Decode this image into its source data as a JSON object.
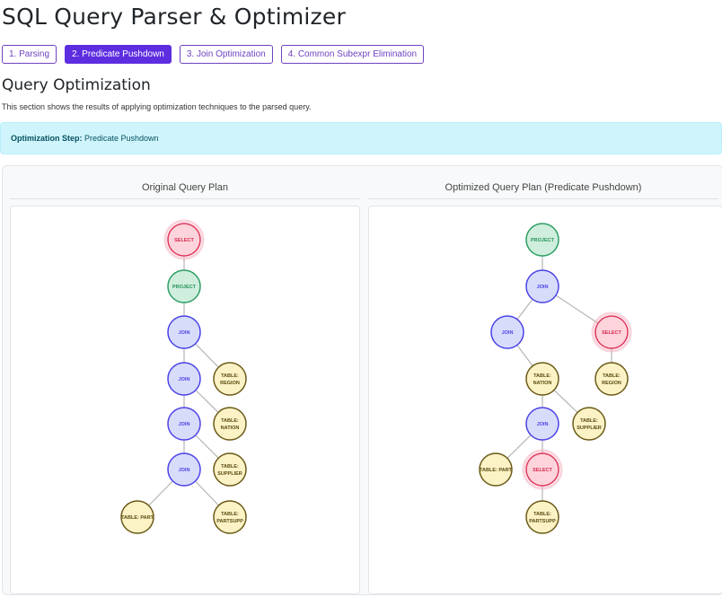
{
  "header": {
    "title": "SQL Query Parser & Optimizer"
  },
  "tabs": [
    {
      "label": "1. Parsing",
      "active": false
    },
    {
      "label": "2. Predicate Pushdown",
      "active": true
    },
    {
      "label": "3. Join Optimization",
      "active": false
    },
    {
      "label": "4. Common Subexpr Elimination",
      "active": false
    }
  ],
  "section": {
    "title": "Query Optimization",
    "description": "This section shows the results of applying optimization techniques to the parsed query."
  },
  "alert": {
    "label": "Optimization Step:",
    "value": "Predicate Pushdown"
  },
  "plans": {
    "original": {
      "title": "Original Query Plan",
      "nodes": [
        {
          "id": "o1",
          "label": [
            "SELECT"
          ],
          "kind": "select"
        },
        {
          "id": "o2",
          "label": [
            "PROJECT"
          ],
          "kind": "project"
        },
        {
          "id": "o3",
          "label": [
            "JOIN"
          ],
          "kind": "join"
        },
        {
          "id": "o4",
          "label": [
            "JOIN"
          ],
          "kind": "join"
        },
        {
          "id": "o5",
          "label": [
            "TABLE:",
            "REGION"
          ],
          "kind": "table"
        },
        {
          "id": "o6",
          "label": [
            "JOIN"
          ],
          "kind": "join"
        },
        {
          "id": "o7",
          "label": [
            "TABLE:",
            "NATION"
          ],
          "kind": "table"
        },
        {
          "id": "o8",
          "label": [
            "JOIN"
          ],
          "kind": "join"
        },
        {
          "id": "o9",
          "label": [
            "TABLE:",
            "SUPPLIER"
          ],
          "kind": "table"
        },
        {
          "id": "o10",
          "label": [
            "TABLE: PART"
          ],
          "kind": "table"
        },
        {
          "id": "o11",
          "label": [
            "TABLE:",
            "PARTSUPP"
          ],
          "kind": "table"
        }
      ],
      "edges": [
        [
          "o1",
          "o2"
        ],
        [
          "o2",
          "o3"
        ],
        [
          "o3",
          "o4"
        ],
        [
          "o3",
          "o5"
        ],
        [
          "o4",
          "o6"
        ],
        [
          "o4",
          "o7"
        ],
        [
          "o6",
          "o8"
        ],
        [
          "o6",
          "o9"
        ],
        [
          "o8",
          "o10"
        ],
        [
          "o8",
          "o11"
        ]
      ]
    },
    "optimized": {
      "title": "Optimized Query Plan (Predicate Pushdown)",
      "nodes": [
        {
          "id": "p1",
          "label": [
            "PROJECT"
          ],
          "kind": "project"
        },
        {
          "id": "p2",
          "label": [
            "JOIN"
          ],
          "kind": "join"
        },
        {
          "id": "p3",
          "label": [
            "JOIN"
          ],
          "kind": "join"
        },
        {
          "id": "p4",
          "label": [
            "SELECT"
          ],
          "kind": "select"
        },
        {
          "id": "p5",
          "label": [
            "TABLE:",
            "NATION"
          ],
          "kind": "table"
        },
        {
          "id": "p6",
          "label": [
            "TABLE:",
            "REGION"
          ],
          "kind": "table"
        },
        {
          "id": "p7",
          "label": [
            "JOIN"
          ],
          "kind": "join"
        },
        {
          "id": "p8",
          "label": [
            "TABLE:",
            "SUPPLIER"
          ],
          "kind": "table"
        },
        {
          "id": "p9",
          "label": [
            "TABLE: PART"
          ],
          "kind": "table"
        },
        {
          "id": "p10",
          "label": [
            "SELECT"
          ],
          "kind": "select"
        },
        {
          "id": "p11",
          "label": [
            "TABLE:",
            "PARTSUPP"
          ],
          "kind": "table"
        }
      ],
      "edges": [
        [
          "p1",
          "p2"
        ],
        [
          "p2",
          "p3"
        ],
        [
          "p2",
          "p4"
        ],
        [
          "p3",
          "p5"
        ],
        [
          "p4",
          "p6"
        ],
        [
          "p5",
          "p7"
        ],
        [
          "p5",
          "p8"
        ],
        [
          "p7",
          "p9"
        ],
        [
          "p7",
          "p10"
        ],
        [
          "p10",
          "p11"
        ]
      ]
    }
  },
  "node_styles": {
    "select": {
      "fill": "#fdd4dc",
      "stroke": "#e0365a",
      "text": "#d6284f"
    },
    "project": {
      "fill": "#cfeedd",
      "stroke": "#2e9e64",
      "text": "#24935a"
    },
    "join": {
      "fill": "#d7dcfb",
      "stroke": "#4c43e6",
      "text": "#4c43e6"
    },
    "table": {
      "fill": "#fbf3c6",
      "stroke": "#6b5a17",
      "text": "#5a4a10"
    }
  },
  "edge_color": "#b5b5b5"
}
